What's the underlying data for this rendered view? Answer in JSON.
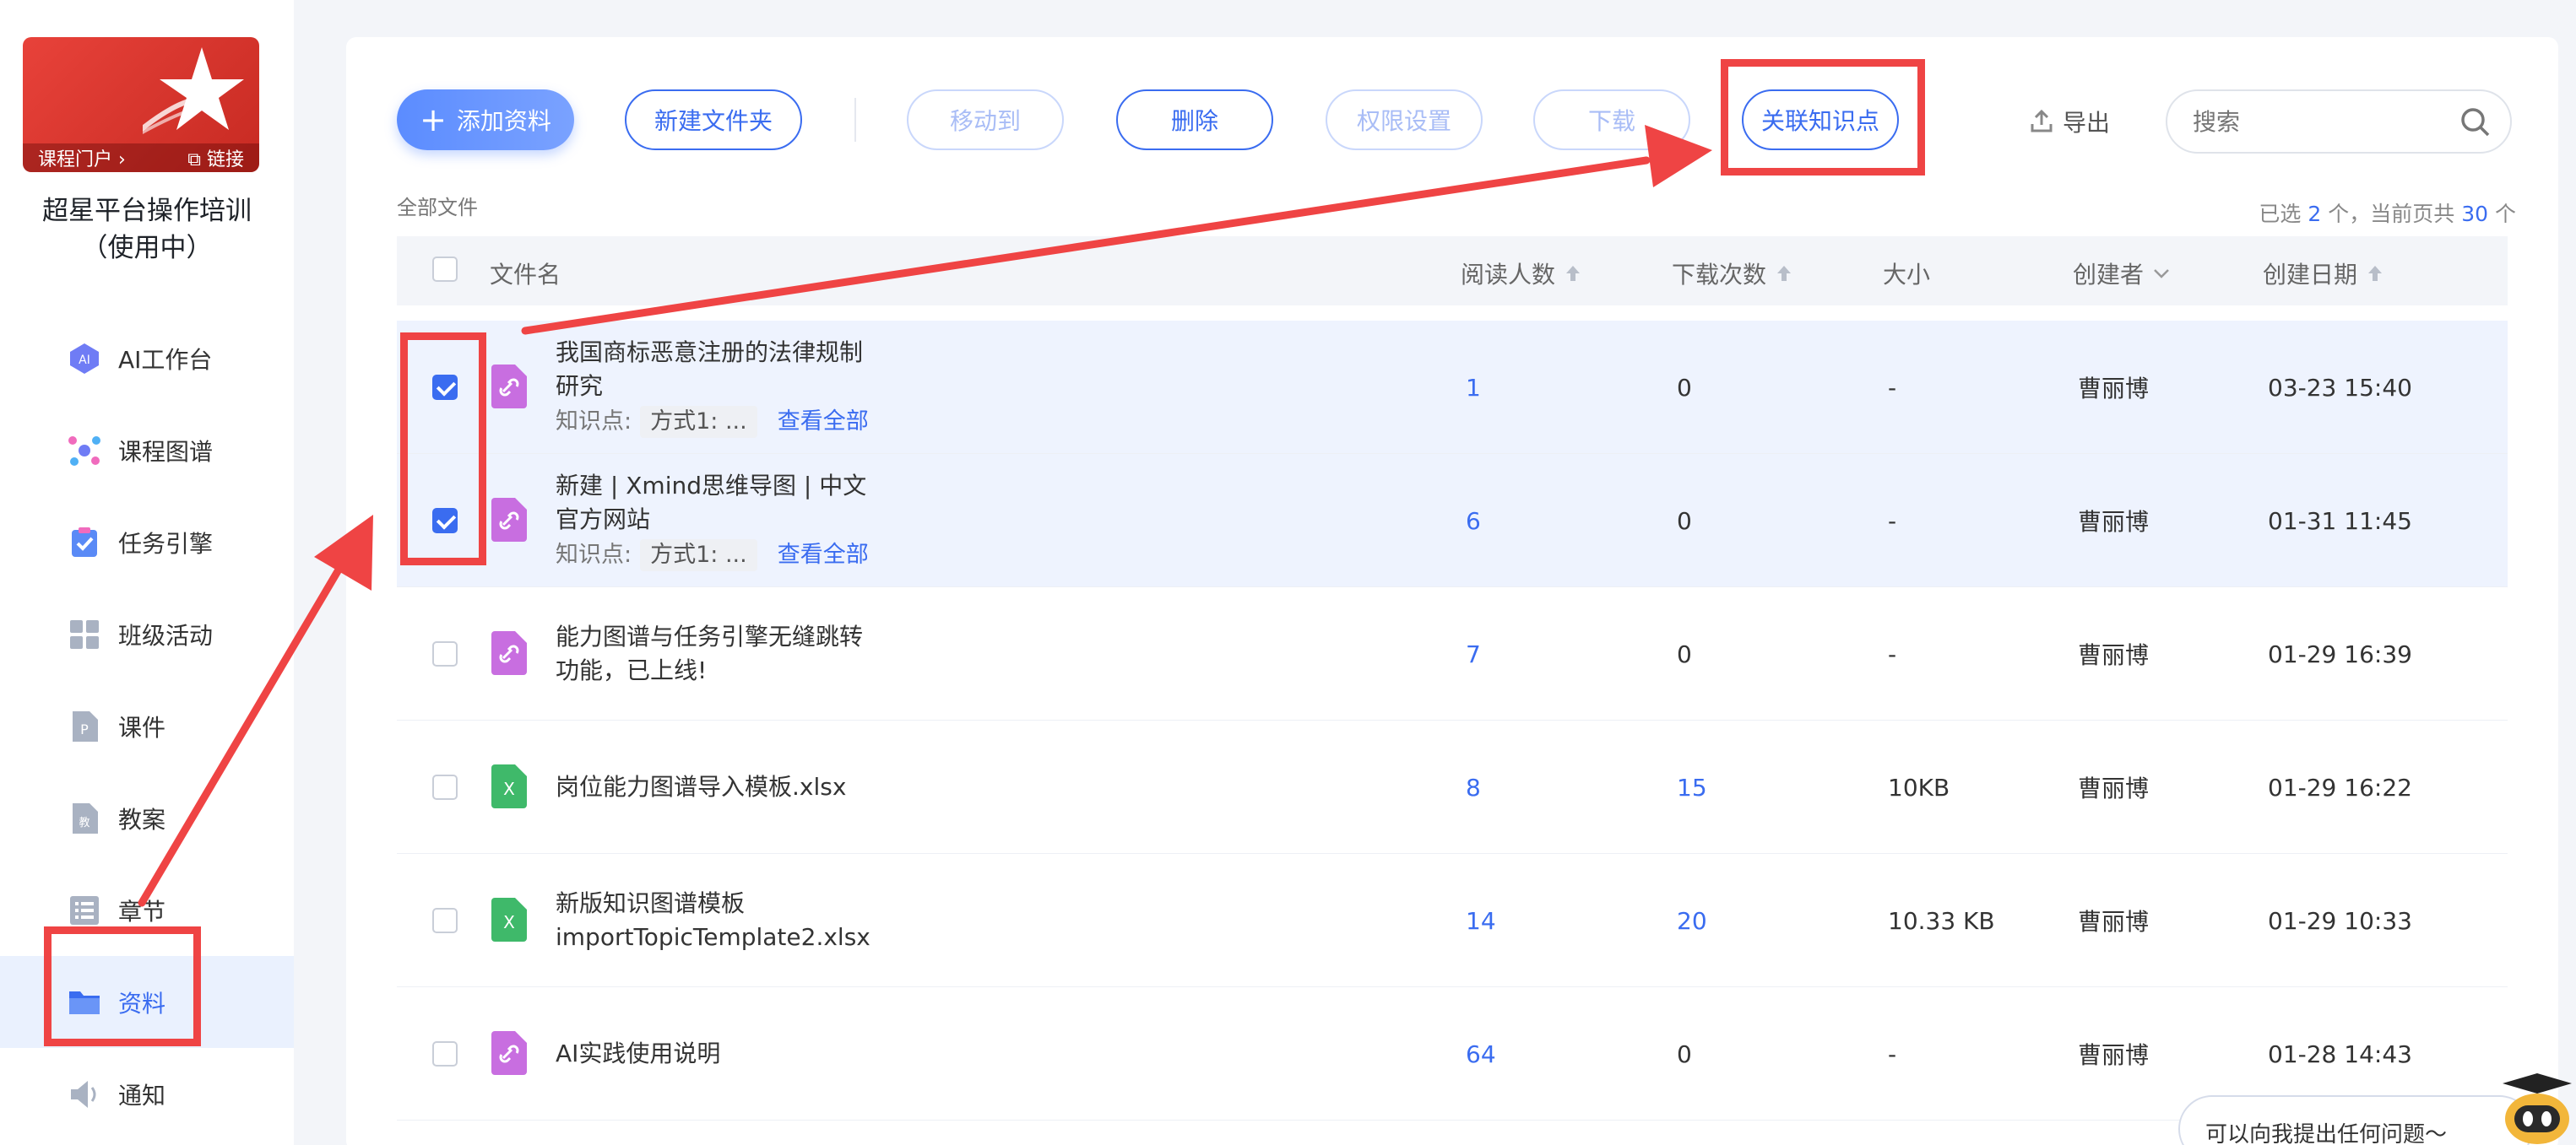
{
  "sidebar": {
    "cover": {
      "portal": "课程门户 ›",
      "link": "⧉ 链接"
    },
    "course_title_line1": "超星平台操作培训",
    "course_title_line2": "（使用中）",
    "items": [
      {
        "label": "AI工作台",
        "icon": "ai-icon"
      },
      {
        "label": "课程图谱",
        "icon": "graph-icon"
      },
      {
        "label": "任务引擎",
        "icon": "task-icon"
      },
      {
        "label": "班级活动",
        "icon": "grid-icon"
      },
      {
        "label": "课件",
        "icon": "courseware-icon"
      },
      {
        "label": "教案",
        "icon": "lesson-plan-icon"
      },
      {
        "label": "章节",
        "icon": "chapter-icon"
      },
      {
        "label": "资料",
        "icon": "folder-icon",
        "active": true
      },
      {
        "label": "通知",
        "icon": "speaker-icon"
      }
    ]
  },
  "toolbar": {
    "add": "添加资料",
    "new_folder": "新建文件夹",
    "move_to": "移动到",
    "delete": "删除",
    "permission": "权限设置",
    "download": "下载",
    "link_knowledge": "关联知识点",
    "export": "导出",
    "search_placeholder": "搜索"
  },
  "breadcrumb": "全部文件",
  "selection": {
    "prefix": "已选",
    "count": "2",
    "middle": "个，当前页共",
    "total": "30",
    "suffix": "个"
  },
  "table": {
    "headers": {
      "name": "文件名",
      "readers": "阅读人数",
      "downloads": "下载次数",
      "size": "大小",
      "creator": "创建者",
      "date": "创建日期"
    },
    "rows": [
      {
        "line1": "我国商标恶意注册的法律规制",
        "line2": "研究",
        "kp_label": "知识点:",
        "kp_tag": "方式1: ...",
        "kp_more": "查看全部",
        "type": "link",
        "readers": "1",
        "downloads": "0",
        "size": "-",
        "creator": "曹丽博",
        "date": "03-23 15:40",
        "checked": true
      },
      {
        "line1": "新建 | Xmind思维导图 | 中文",
        "line2": "官方网站",
        "kp_label": "知识点:",
        "kp_tag": "方式1: ...",
        "kp_more": "查看全部",
        "type": "link",
        "readers": "6",
        "downloads": "0",
        "size": "-",
        "creator": "曹丽博",
        "date": "01-31 11:45",
        "checked": true
      },
      {
        "line1": "能力图谱与任务引擎无缝跳转",
        "line2": "功能，已上线!",
        "type": "link",
        "readers": "7",
        "downloads": "0",
        "size": "-",
        "creator": "曹丽博",
        "date": "01-29 16:39",
        "checked": false
      },
      {
        "line1": "岗位能力图谱导入模板.xlsx",
        "line2": "",
        "type": "excel",
        "readers": "8",
        "downloads": "15",
        "size": "10KB",
        "creator": "曹丽博",
        "date": "01-29 16:22",
        "checked": false
      },
      {
        "line1": "新版知识图谱模板",
        "line2": "importTopicTemplate2.xlsx",
        "type": "excel",
        "readers": "14",
        "downloads": "20",
        "size": "10.33 KB",
        "creator": "曹丽博",
        "date": "01-29 10:33",
        "checked": false
      },
      {
        "line1": "AI实践使用说明",
        "line2": "",
        "type": "link",
        "readers": "64",
        "downloads": "0",
        "size": "-",
        "creator": "曹丽博",
        "date": "01-28 14:43",
        "checked": false
      }
    ]
  },
  "helper": {
    "text": "可以向我提出任何问题～"
  },
  "colors": {
    "accent": "#3a6cf0",
    "annotation": "#ef4444",
    "link_icon": "#c86ee0",
    "excel_icon": "#3fb96a"
  }
}
